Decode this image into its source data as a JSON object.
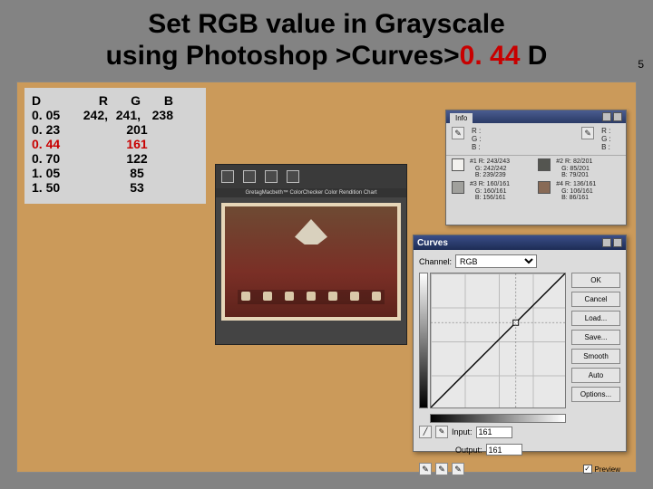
{
  "title": {
    "line1a": "Set RGB value in Grayscale",
    "line2a": "using Photoshop >Curves>",
    "line2b": "0. 44",
    "line2c": " D"
  },
  "sub_index": "5",
  "dtable": {
    "head": {
      "d": "D",
      "r": "R",
      "g": "G",
      "b": "B"
    },
    "rows": [
      {
        "d": "0. 05",
        "r": "242,",
        "g": "241,",
        "b": "238",
        "hl": false
      },
      {
        "d": "0. 23",
        "center": "201",
        "hl": false
      },
      {
        "d": "0. 44",
        "center": "161",
        "hl": true
      },
      {
        "d": "0. 70",
        "center": "122",
        "hl": false
      },
      {
        "d": "1. 05",
        "center": "85",
        "hl": false
      },
      {
        "d": "1. 50",
        "center": "53",
        "hl": false
      }
    ]
  },
  "photo": {
    "caption": "GretagMacbeth™ ColorChecker Color Rendition Chart"
  },
  "info": {
    "tab": "Info",
    "rgb": {
      "r_label": "R :",
      "g_label": "G :",
      "b_label": "B :"
    },
    "samples": [
      {
        "n": "#1",
        "r": "243/243",
        "g": "242/242",
        "b": "239/239",
        "color": "#f2f1ee"
      },
      {
        "n": "#2",
        "r": "82/201",
        "g": "85/201",
        "b": "79/201",
        "color": "#545550"
      },
      {
        "n": "#3",
        "r": "160/161",
        "g": "160/161",
        "b": "156/161",
        "color": "#a0a09c"
      },
      {
        "n": "#4",
        "r": "136/161",
        "g": "106/161",
        "b": "86/161",
        "color": "#886a56"
      }
    ]
  },
  "curves": {
    "title": "Curves",
    "channel_label": "Channel:",
    "channel_value": "RGB",
    "input_label": "Input:",
    "input_value": "161",
    "output_label": "Output:",
    "output_value": "161",
    "buttons": {
      "ok": "OK",
      "cancel": "Cancel",
      "load": "Load...",
      "save": "Save...",
      "smooth": "Smooth",
      "auto": "Auto",
      "options": "Options..."
    },
    "preview_label": "Preview",
    "preview_checked": true
  },
  "chart_data": {
    "type": "line",
    "title": "Photoshop Curves (identity with control point at 161)",
    "xlabel": "Input",
    "ylabel": "Output",
    "xlim": [
      0,
      255
    ],
    "ylim": [
      0,
      255
    ],
    "series": [
      {
        "name": "RGB curve",
        "x": [
          0,
          161,
          255
        ],
        "y": [
          0,
          161,
          255
        ]
      }
    ],
    "control_point": {
      "x": 161,
      "y": 161
    }
  }
}
